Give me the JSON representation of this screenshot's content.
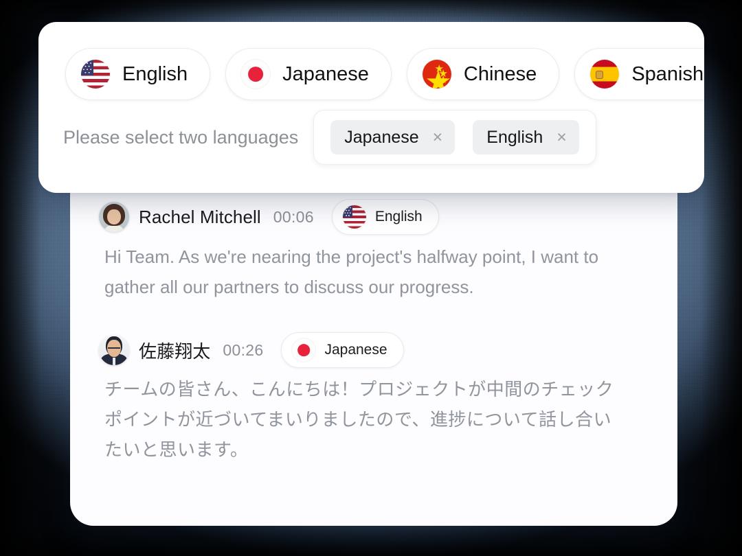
{
  "background": {
    "base_color": "#7d9bbd",
    "vignette_color": "#000000"
  },
  "language_selector": {
    "available_languages": [
      {
        "label": "English",
        "flag": "flag-us-icon",
        "flag_code": "us"
      },
      {
        "label": "Japanese",
        "flag": "flag-jp-icon",
        "flag_code": "jp"
      },
      {
        "label": "Chinese",
        "flag": "flag-cn-icon",
        "flag_code": "cn"
      },
      {
        "label": "Spanish",
        "flag": "flag-es-icon",
        "flag_code": "es"
      }
    ],
    "hint": "Please select two languages",
    "selected": [
      {
        "label": "Japanese",
        "close": "×"
      },
      {
        "label": "English",
        "close": "×"
      }
    ]
  },
  "conversation": {
    "messages": [
      {
        "speaker": "Rachel Mitchell",
        "speaker_script": "latin",
        "timestamp": "00:06",
        "language_badge": "English",
        "flag_code": "us",
        "avatar": "avatar-rachel-mitchell",
        "text": "Hi Team. As we're nearing the project's halfway point, I want to gather all our partners to discuss our progress."
      },
      {
        "speaker": "佐藤翔太",
        "speaker_script": "japanese",
        "timestamp": "00:26",
        "language_badge": "Japanese",
        "flag_code": "jp",
        "avatar": "avatar-sato-shota",
        "text": "チームの皆さん、こんにちは！プロジェクトが中間のチェックポイントが近づいてまいりましたので、進捗について話し合いたいと思います。"
      }
    ]
  }
}
